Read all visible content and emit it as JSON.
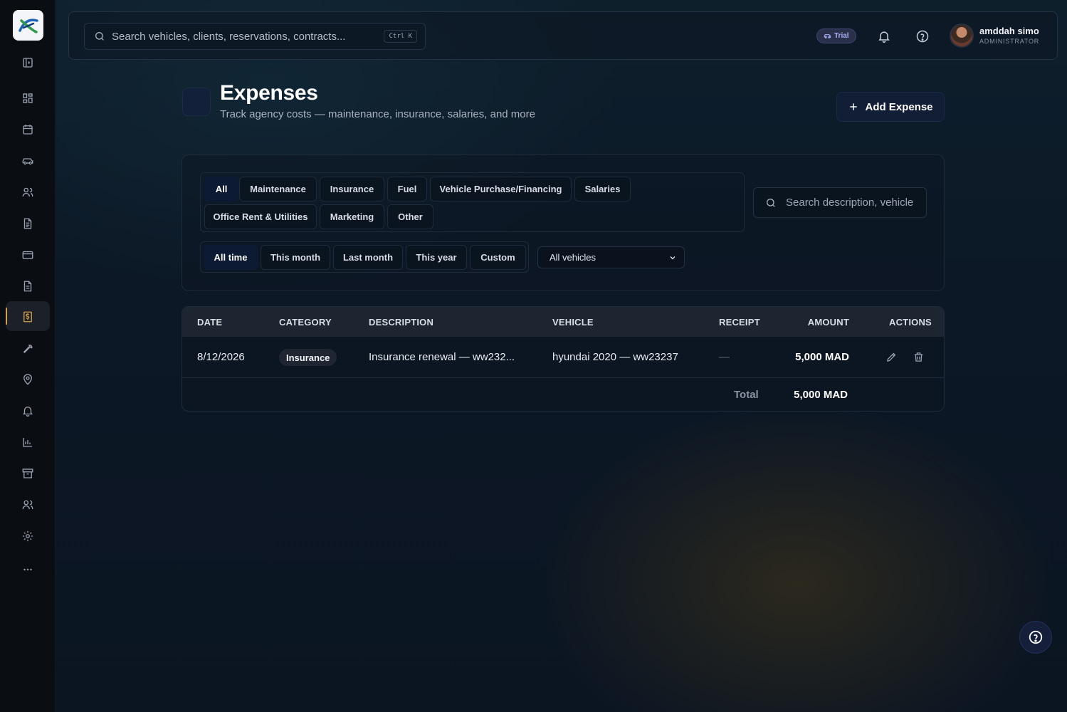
{
  "topbar": {
    "search_placeholder": "Search vehicles, clients, reservations, contracts...",
    "shortcut": "Ctrl K",
    "trial_label": "Trial",
    "user": {
      "name": "amddah simo",
      "role": "ADMINISTRATOR"
    }
  },
  "sidebar": {
    "items": [
      {
        "icon": "sidebar-toggle-icon"
      },
      {
        "icon": "dashboard-icon"
      },
      {
        "icon": "calendar-icon"
      },
      {
        "icon": "car-icon"
      },
      {
        "icon": "users-icon"
      },
      {
        "icon": "contract-icon"
      },
      {
        "icon": "credit-card-icon"
      },
      {
        "icon": "invoice-icon"
      },
      {
        "icon": "expenses-icon",
        "active": true
      },
      {
        "icon": "wrench-icon"
      },
      {
        "icon": "location-icon"
      },
      {
        "icon": "bell-icon"
      },
      {
        "icon": "reports-icon"
      },
      {
        "icon": "archive-icon"
      },
      {
        "icon": "team-icon"
      },
      {
        "icon": "settings-icon"
      },
      {
        "icon": "more-icon"
      }
    ]
  },
  "header": {
    "title": "Expenses",
    "subtitle": "Track agency costs — maintenance, insurance, salaries, and more",
    "add_button": "Add Expense"
  },
  "filters": {
    "categories": [
      {
        "label": "All",
        "active": true
      },
      {
        "label": "Maintenance"
      },
      {
        "label": "Insurance"
      },
      {
        "label": "Fuel"
      },
      {
        "label": "Vehicle Purchase/Financing"
      },
      {
        "label": "Salaries"
      },
      {
        "label": "Office Rent & Utilities"
      },
      {
        "label": "Marketing"
      },
      {
        "label": "Other"
      }
    ],
    "periods": [
      {
        "label": "All time",
        "active": true
      },
      {
        "label": "This month"
      },
      {
        "label": "Last month"
      },
      {
        "label": "This year"
      },
      {
        "label": "Custom"
      }
    ],
    "vehicle_select": "All vehicles",
    "search_placeholder": "Search description, vehicle"
  },
  "table": {
    "headers": [
      "DATE",
      "CATEGORY",
      "DESCRIPTION",
      "VEHICLE",
      "RECEIPT",
      "AMOUNT",
      "ACTIONS"
    ],
    "rows": [
      {
        "date": "8/12/2026",
        "category": "Insurance",
        "description": "Insurance renewal — ww232...",
        "vehicle": "hyundai 2020 — ww23237",
        "receipt": "—",
        "amount": "5,000 MAD"
      }
    ],
    "total_label": "Total",
    "total_value": "5,000 MAD"
  },
  "colors": {
    "accent": "#d4a24a",
    "primary_button": "#121d36",
    "background": "#0b1524"
  }
}
